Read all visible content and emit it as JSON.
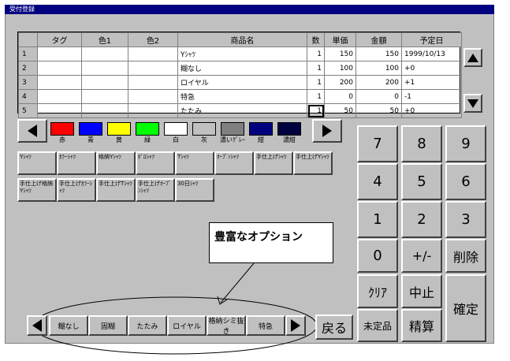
{
  "window": {
    "title": "受付登録"
  },
  "table": {
    "columns": [
      "",
      "タグ",
      "色1",
      "色2",
      "商品名",
      "数",
      "単価",
      "金額",
      "予定日"
    ],
    "rows": [
      {
        "no": "1",
        "tag": "",
        "c1": "",
        "c2": "",
        "name": "Yｼｬﾂ",
        "qty": "1",
        "price": "150",
        "amount": "150",
        "date": "1999/10/13"
      },
      {
        "no": "2",
        "tag": "",
        "c1": "",
        "c2": "",
        "name": "糊なし",
        "qty": "1",
        "price": "100",
        "amount": "100",
        "date": "+0"
      },
      {
        "no": "3",
        "tag": "",
        "c1": "",
        "c2": "",
        "name": "ロイヤル",
        "qty": "1",
        "price": "200",
        "amount": "200",
        "date": "+1"
      },
      {
        "no": "4",
        "tag": "",
        "c1": "",
        "c2": "",
        "name": "特急",
        "qty": "1",
        "price": "0",
        "amount": "0",
        "date": "-1"
      },
      {
        "no": "5",
        "tag": "",
        "c1": "",
        "c2": "",
        "name": "たたみ",
        "qty": "1",
        "price": "50",
        "amount": "50",
        "date": "+0"
      }
    ]
  },
  "colors": [
    {
      "label": "赤",
      "hex": "#ff0000"
    },
    {
      "label": "青",
      "hex": "#0000ff"
    },
    {
      "label": "黄",
      "hex": "#ffff00"
    },
    {
      "label": "緑",
      "hex": "#00ff00"
    },
    {
      "label": "白",
      "hex": "#ffffff"
    },
    {
      "label": "灰",
      "hex": "#c0c0c0"
    },
    {
      "label": "濃いｸﾞﾚｰ",
      "hex": "#808080"
    },
    {
      "label": "紺",
      "hex": "#000080"
    },
    {
      "label": "濃紺",
      "hex": "#000040"
    }
  ],
  "products_row1": [
    "Yｼｬﾂ",
    "ｶﾗｰｼｬﾂ",
    "格納Yｼｬﾂ",
    "ﾎﾟﾛｼｬﾂ",
    "Tｼｬﾂ",
    "ｵｰﾌﾟﾝｼｬﾂ",
    "手仕上げｼｬﾂ",
    "手仕上げYｼｬﾂ"
  ],
  "products_row2": [
    "手仕上げ格納Yｼｬﾂ",
    "手仕上げｶﾗｰｼｬﾂ",
    "手仕上げTｼｬﾂ",
    "手仕上げｵｰﾌﾟﾝｼｬﾂ",
    "30日ｼｬﾂ"
  ],
  "keypad": {
    "k7": "7",
    "k8": "8",
    "k9": "9",
    "k4": "4",
    "k5": "5",
    "k6": "6",
    "k1": "1",
    "k2": "2",
    "k3": "3",
    "k0": "0",
    "plusminus": "+/-",
    "delete": "削除",
    "clear": "ｸﾘｱ",
    "cancel": "中止",
    "confirm": "確定",
    "undetermined": "未定品",
    "checkout": "精算"
  },
  "options": [
    "糊なし",
    "固糊",
    "たたみ",
    "ロイヤル",
    "格納シミ抜き",
    "特急"
  ],
  "back_label": "戻る",
  "callout": "豊富なオプション"
}
